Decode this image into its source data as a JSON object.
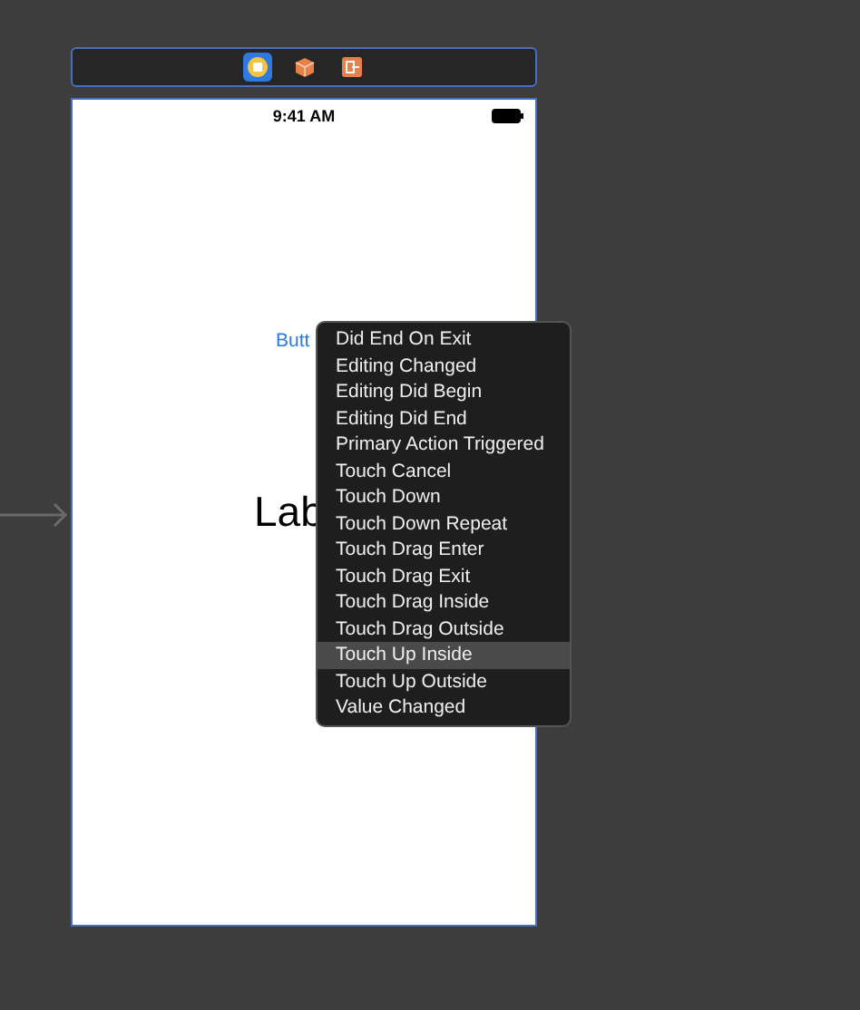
{
  "scene_dock": {
    "icons": [
      {
        "kind": "view-controller",
        "selected": true
      },
      {
        "kind": "first-responder",
        "selected": false
      },
      {
        "kind": "exit",
        "selected": false
      }
    ]
  },
  "phone": {
    "status_bar": {
      "time": "9:41 AM"
    },
    "button": {
      "label": "Butt"
    },
    "label": {
      "text": "Lab"
    }
  },
  "events_menu": {
    "items": [
      {
        "label": "Did End On Exit",
        "selected": false
      },
      {
        "label": "Editing Changed",
        "selected": false
      },
      {
        "label": "Editing Did Begin",
        "selected": false
      },
      {
        "label": "Editing Did End",
        "selected": false
      },
      {
        "label": "Primary Action Triggered",
        "selected": false
      },
      {
        "label": "Touch Cancel",
        "selected": false
      },
      {
        "label": "Touch Down",
        "selected": false
      },
      {
        "label": "Touch Down Repeat",
        "selected": false
      },
      {
        "label": "Touch Drag Enter",
        "selected": false
      },
      {
        "label": "Touch Drag Exit",
        "selected": false
      },
      {
        "label": "Touch Drag Inside",
        "selected": false
      },
      {
        "label": "Touch Drag Outside",
        "selected": false
      },
      {
        "label": "Touch Up Inside",
        "selected": true
      },
      {
        "label": "Touch Up Outside",
        "selected": false
      },
      {
        "label": "Value Changed",
        "selected": false
      }
    ]
  }
}
